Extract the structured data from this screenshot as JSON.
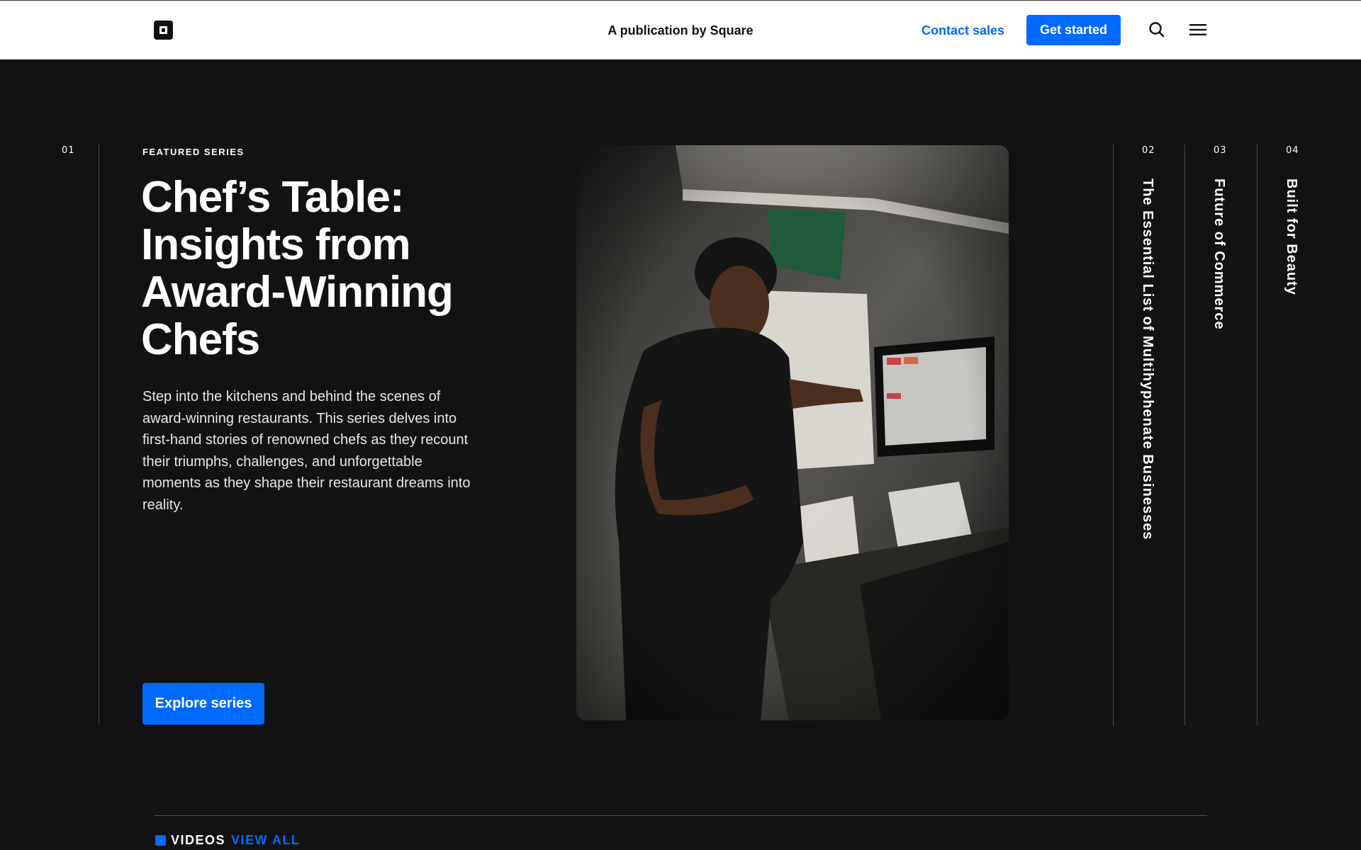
{
  "header": {
    "publication": "A publication by Square",
    "contact_label": "Contact sales",
    "cta_label": "Get started"
  },
  "slides": [
    {
      "number": "01",
      "eyebrow": "FEATURED SERIES",
      "title": "Chef’s Table: Insights from Award-Winning Chefs",
      "description": "Step into the kitchens and behind the scenes of award-winning restaurants. This series delves into first-hand stories of renowned chefs as they recount their triumphs, challenges, and unforgettable moments as they shape their restaurant dreams into reality.",
      "button_label": "Explore series",
      "image_icon": "chef-kitchen-photo"
    },
    {
      "number": "02",
      "title": "The Essential List of Multihyphenate Businesses"
    },
    {
      "number": "03",
      "title": "Future of Commerce"
    },
    {
      "number": "04",
      "title": "Built for Beauty"
    }
  ],
  "section": {
    "label": "VIDEOS",
    "link": "VIEW ALL"
  },
  "colors": {
    "accent": "#006aff",
    "background": "#121212",
    "header_bg": "#ffffff"
  }
}
